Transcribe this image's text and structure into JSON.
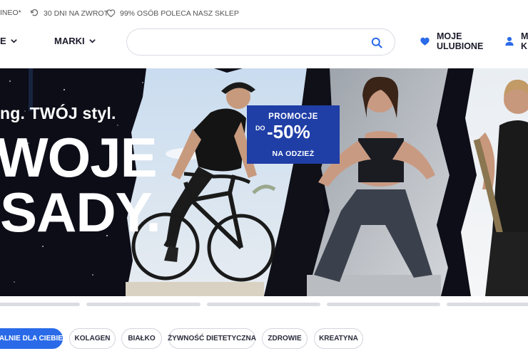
{
  "topbar": {
    "item1": "INEO*",
    "item2": "30 DNI NA ZWROT",
    "item3": "99% OSÓB POLECA NASZ SKLEP"
  },
  "nav": {
    "item1": "E",
    "item2": "MARKI",
    "search_value": "",
    "favorites_line1": "MOJE",
    "favorites_line2": "ULUBIONE",
    "account_line1": "M",
    "account_line2": "K"
  },
  "hero": {
    "tagline": "ng. TWÓJ styl.",
    "headline_line1": "WOJE",
    "headline_line2": "SADY.",
    "promo_line1": "PROMOCJE",
    "promo_do": "DO",
    "promo_value": "-50%",
    "promo_line3": "NA ODZIEŻ"
  },
  "slider": {
    "slide_count": 5,
    "active_index": 0
  },
  "chips": [
    "CJALNIE DLA CIEBIE",
    "KOLAGEN",
    "BIAŁKO",
    "ŻYWNOŚĆ DIETETYCZNA",
    "ZDROWIE",
    "KREATYNA"
  ],
  "colors": {
    "accent": "#2a6ae8",
    "promo": "#1f3ea6",
    "text": "#1b1b2b"
  }
}
